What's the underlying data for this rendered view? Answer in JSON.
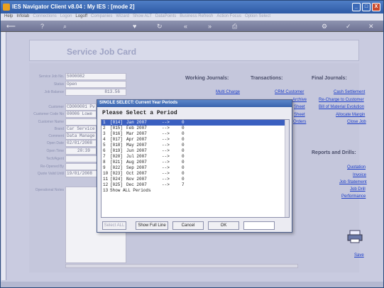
{
  "window": {
    "title": "IES Navigator Client v8.04 : My IES :     [mode 2]",
    "minimize": "_",
    "maximize": "□",
    "close": "X"
  },
  "menu": {
    "items": [
      {
        "label": "Help",
        "dim": false
      },
      {
        "label": "Infolab",
        "dim": false
      },
      {
        "label": "Connections",
        "dim": true
      },
      {
        "label": "Logon",
        "dim": true
      },
      {
        "label": "Logoff",
        "dim": false
      },
      {
        "label": "Companies",
        "dim": true
      },
      {
        "label": "Wizard",
        "dim": true
      },
      {
        "label": "Show ALT",
        "dim": true
      },
      {
        "label": "DataPoints",
        "dim": true
      },
      {
        "label": "Business Refresh",
        "dim": true
      },
      {
        "label": "Action Focus",
        "dim": true
      },
      {
        "label": "Option Select",
        "dim": true
      }
    ]
  },
  "toolbar": {
    "icons": [
      "back-arrow-icon",
      "help-icon",
      "search-icon",
      "heart-icon",
      "refresh-icon",
      "rewind-icon",
      "forward-icon",
      "print-icon",
      "settings-icon",
      "check-icon",
      "close-icon"
    ]
  },
  "form": {
    "title": "Service Job Card",
    "fields": [
      {
        "label": "Service Job No.",
        "value": "5000082"
      },
      {
        "label": "Status",
        "value": "Open"
      },
      {
        "label": "Job Balance",
        "value": "813.56"
      },
      {
        "label": "Customer",
        "value": "CD000001 Pv"
      },
      {
        "label": "Customer Code No",
        "value": "00006 Lowe"
      },
      {
        "label": "Customer Name",
        "value": ""
      },
      {
        "label": "Brand",
        "value": "Car Service"
      },
      {
        "label": "Comment",
        "value": "Data Manage"
      },
      {
        "label": "Open Date",
        "value": "02/01/2008"
      },
      {
        "label": "Open Time",
        "value": "20:39"
      },
      {
        "label": "Tech/Agent",
        "value": ""
      },
      {
        "label": "Re-Opened By",
        "value": ""
      },
      {
        "label": "Quote Valid Until",
        "value": "19/01/2008"
      },
      {
        "label": "Operational Notes",
        "value": ""
      }
    ]
  },
  "columns": {
    "working_journals": "Working Journals:",
    "transactions": "Transactions:",
    "final_journals": "Final Journals:",
    "reports": "Reports and Drills:"
  },
  "links": {
    "multi_charge": "Multi Charge",
    "crm_customer": "CRM Customer",
    "archive": "Archive",
    "sheet1": "Sheet",
    "sheet2": "Sheet",
    "orders": "Orders",
    "cash_settlement": "Cash Settlement",
    "recharge": "Re-Charge to Customer",
    "bom": "Bill of Material Evolution",
    "allocate_margin": "Allocate Margin",
    "close_job": "Close Job",
    "quotation": "Quotation",
    "invoice": "Invoice",
    "job_statement": "Job Statement",
    "job_drill": "Job Drill",
    "performance": "Performance",
    "save": "Save"
  },
  "dialog": {
    "title": "SINGLE SELECT: Current Year Periods",
    "prompt": "Please Select a Period",
    "rows": [
      {
        "n": "1",
        "code": "[014]",
        "period": "Jan 2007",
        "arrow": "-->",
        "count": "0",
        "selected": true
      },
      {
        "n": "2",
        "code": "[015]",
        "period": "Feb 2007",
        "arrow": "-->",
        "count": "0",
        "selected": false
      },
      {
        "n": "3",
        "code": "[016]",
        "period": "Mar 2007",
        "arrow": "-->",
        "count": "0",
        "selected": false
      },
      {
        "n": "4",
        "code": "[017]",
        "period": "Apr 2007",
        "arrow": "-->",
        "count": "0",
        "selected": false
      },
      {
        "n": "5",
        "code": "[018]",
        "period": "May 2007",
        "arrow": "-->",
        "count": "0",
        "selected": false
      },
      {
        "n": "6",
        "code": "[019]",
        "period": "Jun 2007",
        "arrow": "-->",
        "count": "0",
        "selected": false
      },
      {
        "n": "7",
        "code": "[020]",
        "period": "Jul 2007",
        "arrow": "-->",
        "count": "0",
        "selected": false
      },
      {
        "n": "8",
        "code": "[021]",
        "period": "Aug 2007",
        "arrow": "-->",
        "count": "0",
        "selected": false
      },
      {
        "n": "9",
        "code": "[022]",
        "period": "Sep 2007",
        "arrow": "-->",
        "count": "0",
        "selected": false
      },
      {
        "n": "10",
        "code": "[023]",
        "period": "Oct 2007",
        "arrow": "-->",
        "count": "0",
        "selected": false
      },
      {
        "n": "11",
        "code": "[024]",
        "period": "Nov 2007",
        "arrow": "-->",
        "count": "0",
        "selected": false
      },
      {
        "n": "12",
        "code": "[025]",
        "period": "Dec 2007",
        "arrow": "-->",
        "count": "7",
        "selected": false
      },
      {
        "n": "13",
        "code": "Show ALL Periods",
        "period": "",
        "arrow": "",
        "count": "",
        "selected": false
      }
    ],
    "buttons": {
      "select_all": "Select ALL",
      "show_full_line": "Show Full Line",
      "cancel": "Cancel",
      "ok": "OK"
    }
  }
}
